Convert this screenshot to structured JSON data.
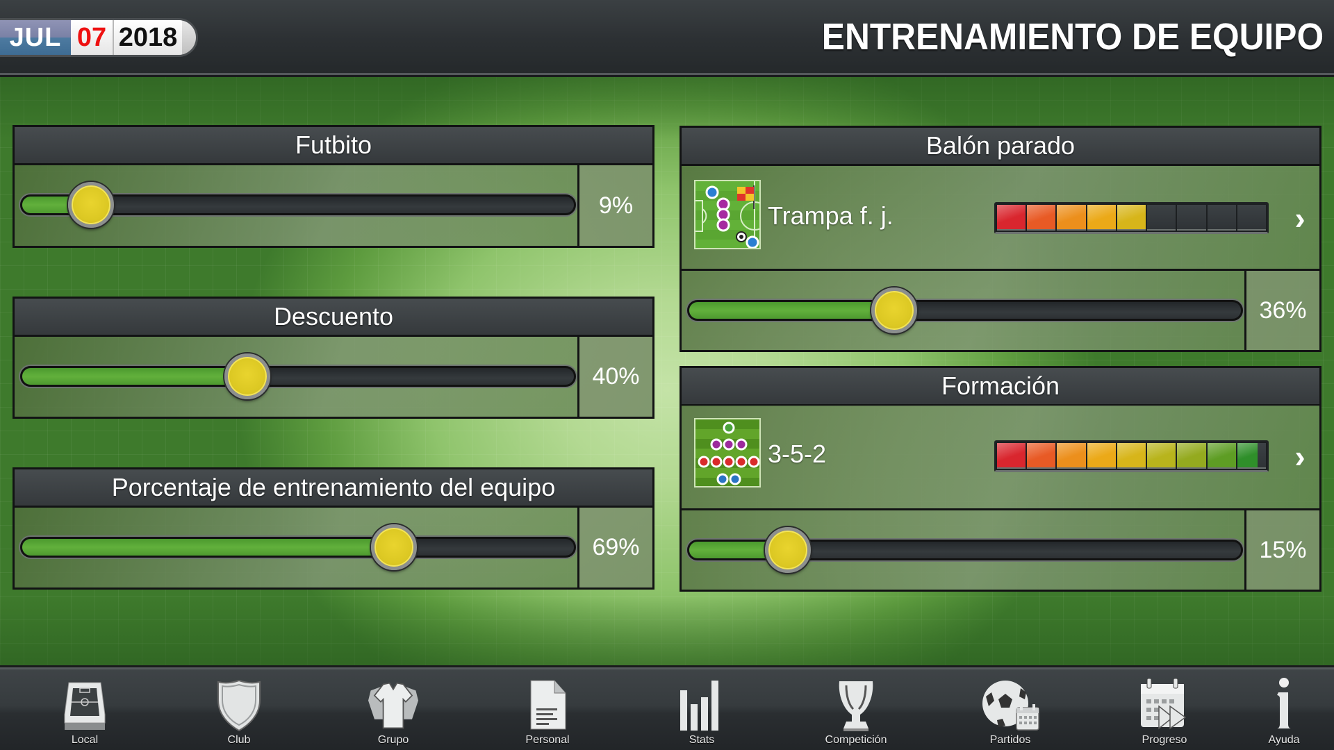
{
  "header": {
    "date": {
      "month": "JUL",
      "day": "07",
      "year": "2018"
    },
    "title": "ENTRENAMIENTO DE EQUIPO"
  },
  "panels": {
    "futbito": {
      "title": "Futbito",
      "value": 9,
      "value_label": "9%"
    },
    "descuento": {
      "title": "Descuento",
      "value": 40,
      "value_label": "40%"
    },
    "porcentaje": {
      "title": "Porcentaje de entrenamiento del equipo",
      "value": 69,
      "value_label": "69%"
    },
    "balon_parado": {
      "title": "Balón parado",
      "selection": "Trampa f. j.",
      "icon": "set-piece-diagram-icon",
      "rating": {
        "filled_segments": 5,
        "total_segments": 9
      },
      "value": 36,
      "value_label": "36%"
    },
    "formacion": {
      "title": "Formación",
      "selection": "3-5-2",
      "icon": "formation-diagram-icon",
      "rating": {
        "filled_segments": 8.7,
        "total_segments": 9
      },
      "value": 15,
      "value_label": "15%"
    }
  },
  "rating_colors": [
    "#d9262e",
    "#e85a25",
    "#ec8f1c",
    "#eba918",
    "#d7b51a",
    "#b8b41c",
    "#94aa1f",
    "#5e9d24",
    "#2f8f2a"
  ],
  "nav": [
    {
      "label": "Local",
      "icon": "stadium-icon"
    },
    {
      "label": "Club",
      "icon": "shield-icon"
    },
    {
      "label": "Grupo",
      "icon": "shirts-icon"
    },
    {
      "label": "Personal",
      "icon": "document-icon"
    },
    {
      "label": "Stats",
      "icon": "bar-chart-icon"
    },
    {
      "label": "Competición",
      "icon": "trophy-icon"
    },
    {
      "label": "Partidos",
      "icon": "ball-calendar-icon"
    },
    {
      "label": "Progreso",
      "icon": "calendar-forward-icon"
    },
    {
      "label": "Ayuda",
      "icon": "info-icon"
    }
  ]
}
